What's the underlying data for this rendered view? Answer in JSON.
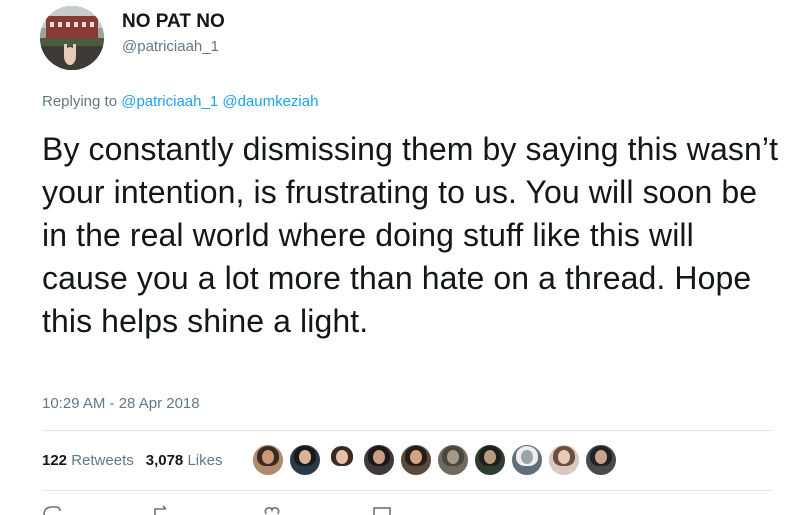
{
  "user": {
    "display_name": "NO PAT NO",
    "handle": "@patriciaah_1"
  },
  "reply": {
    "prefix": "Replying to",
    "mentions": [
      "@patriciaah_1",
      "@daumkeziah"
    ]
  },
  "tweet": {
    "text": "By constantly dismissing them by saying this wasn’t your intention, is frustrating to us. You will soon be in the real world where doing stuff like this will cause you a lot more than hate on a thread. Hope this helps shine a light.",
    "timestamp": "10:29 AM - 28 Apr 2018"
  },
  "stats": {
    "retweets_count": "122",
    "retweets_label": "Retweets",
    "likes_count": "3,078",
    "likes_label": "Likes"
  },
  "likers": [
    {
      "name": "liker-avatar-1",
      "bg": "#b08a6a",
      "hair": "#3b2a1e",
      "skin": "#c99a7a"
    },
    {
      "name": "liker-avatar-2",
      "bg": "#2a3a4a",
      "hair": "#1a1a1a",
      "skin": "#d6b49a"
    },
    {
      "name": "liker-avatar-3",
      "bg": "#ffffff",
      "hair": "#3a2a22",
      "skin": "#e4c2a8"
    },
    {
      "name": "liker-avatar-4",
      "bg": "#3e3a3a",
      "hair": "#1c1818",
      "skin": "#c79e86"
    },
    {
      "name": "liker-avatar-5",
      "bg": "#5a4a3e",
      "hair": "#2a1c14",
      "skin": "#cfa383"
    },
    {
      "name": "liker-avatar-6",
      "bg": "#6e6a60",
      "hair": "#4a4640",
      "skin": "#a39a88"
    },
    {
      "name": "liker-avatar-7",
      "bg": "#2e3e2e",
      "hair": "#1e1e1e",
      "skin": "#b89a7e"
    },
    {
      "name": "liker-avatar-8",
      "bg": "#5e6e7a",
      "hair": "#eeeeee",
      "skin": "#9aa3aa"
    },
    {
      "name": "liker-avatar-9",
      "bg": "#d8c8c0",
      "hair": "#6a4e3e",
      "skin": "#e8cbb6"
    },
    {
      "name": "liker-avatar-10",
      "bg": "#4a4a4a",
      "hair": "#222222",
      "skin": "#c8a48c"
    }
  ],
  "colors": {
    "link": "#1da1f2",
    "secondary_text": "#657786",
    "primary_text": "#14171a",
    "divider": "#e1e8ed"
  },
  "icons": [
    "reply-icon",
    "retweet-icon",
    "like-icon",
    "message-icon"
  ]
}
